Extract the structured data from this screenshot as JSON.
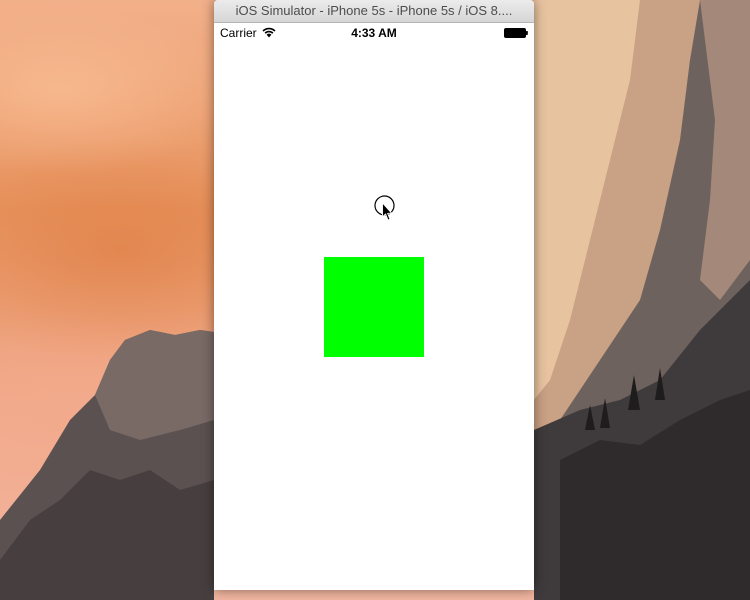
{
  "desktop": {
    "wallpaper": "yosemite-wallpaper"
  },
  "window": {
    "title": "iOS Simulator - iPhone 5s - iPhone 5s / iOS 8...."
  },
  "statusbar": {
    "carrier": "Carrier",
    "time": "4:33 AM",
    "wifi_icon": "wifi-icon",
    "battery_icon": "battery-icon"
  },
  "screen": {
    "background_color": "#ffffff",
    "square_color": "#00ff00"
  },
  "cursor": {
    "icon": "touch-cursor-icon"
  }
}
